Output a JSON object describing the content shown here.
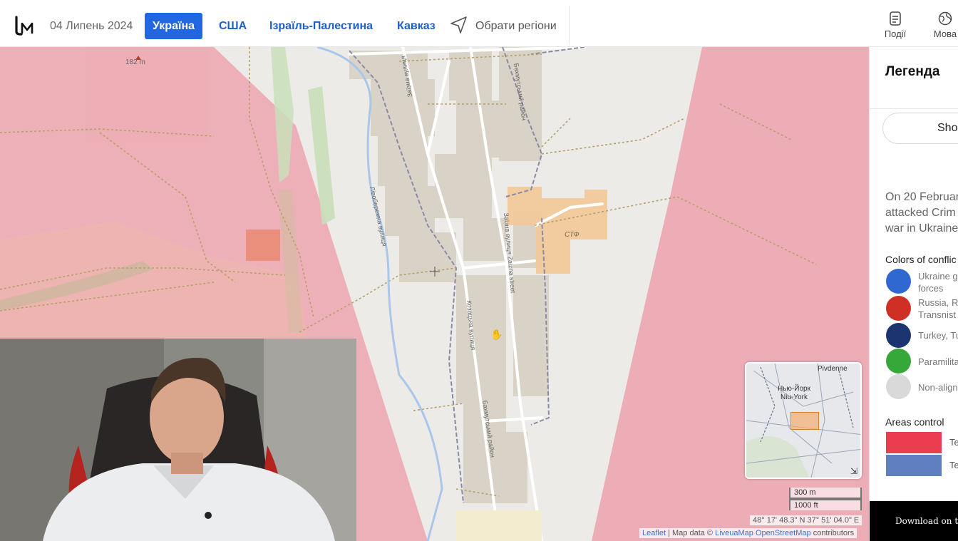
{
  "header": {
    "date": "04 Липень 2024",
    "nav": [
      {
        "label": "Україна",
        "active": true
      },
      {
        "label": "США",
        "active": false
      },
      {
        "label": "Ізраїль-Палестина",
        "active": false
      },
      {
        "label": "Кавказ",
        "active": false
      }
    ],
    "regions_label": "Обрати регіони",
    "events_label": "Події",
    "language_label": "Мова"
  },
  "map": {
    "elevation": "182 m",
    "poi_label": "СТФ",
    "streets": [
      "Бахмутський район",
      "Заїзна вулиця",
      "Заїзна вулиця Zaizna street",
      "Козацька вулиця",
      "Бахмутський район",
      "Лівобережна вулиця"
    ],
    "minimap": {
      "labels": [
        "Pivdenne",
        "Нью-Йорк",
        "Niu-York"
      ]
    },
    "scale": {
      "metric": "300 m",
      "imperial": "1000 ft"
    },
    "coordinates": "48° 17' 48.3\" N 37° 51' 04.0\" E",
    "attribution": {
      "leaflet": "Leaflet",
      "sep": " | Map data © ",
      "liveuamap": "LiveuaMap",
      "osm": "OpenStreetMap",
      "suffix": " contributors"
    },
    "colors": {
      "occupied_area": "#eda7b2",
      "land": "#ecebe8",
      "river": "#a9c7ea"
    }
  },
  "panel": {
    "legend_title": "Легенда",
    "show_button": "Sho",
    "description": [
      "On 20 Februar",
      "attacked Crim",
      "war in Ukraine"
    ],
    "colors_title": "Colors of conflic",
    "conflict_colors": [
      {
        "lines": [
          "Ukraine g",
          "forces"
        ],
        "color": "#2f68d0"
      },
      {
        "lines": [
          "Russia, R",
          "Transnist"
        ],
        "color": "#cf2f25"
      },
      {
        "lines": [
          "Turkey, Tu"
        ],
        "color": "#1c3470"
      },
      {
        "lines": [
          "Paramilita"
        ],
        "color": "#36a83a"
      },
      {
        "lines": [
          "Non-align"
        ],
        "color": "#d9d9d9"
      }
    ],
    "areas_title": "Areas control",
    "areas": [
      {
        "label": "Te",
        "color": "#ea3d4f"
      },
      {
        "label": "Te",
        "color": "#5f7fc1"
      }
    ],
    "download": "Download on the"
  }
}
